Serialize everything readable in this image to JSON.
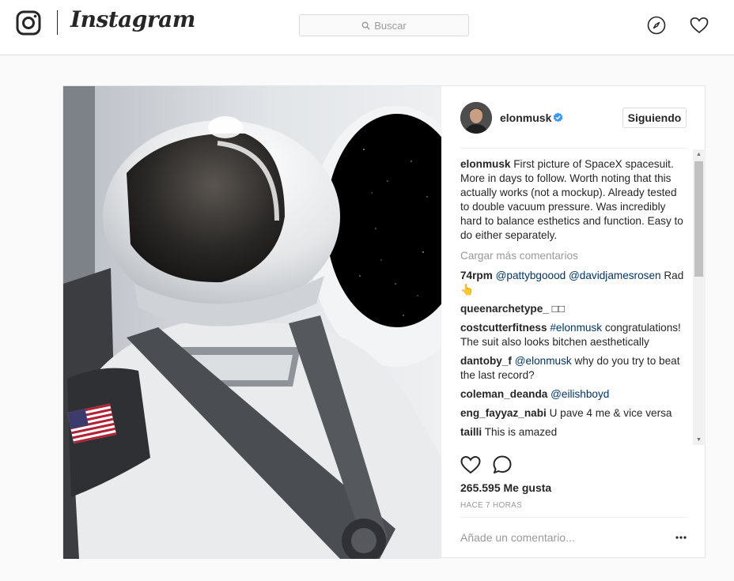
{
  "header": {
    "wordmark": "Instagram",
    "search_placeholder": "Buscar",
    "icons": [
      "instagram-glyph-icon",
      "search-icon",
      "compass-icon",
      "heart-icon"
    ]
  },
  "post": {
    "author": {
      "username": "elonmusk",
      "follow_label": "Siguiendo"
    },
    "caption": {
      "username": "elonmusk",
      "text": "First picture of SpaceX spacesuit. More in days to follow. Worth noting that this actually works (not a mockup). Already tested to double vacuum pressure. Was incredibly hard to balance esthetics and function. Easy to do either separately."
    },
    "load_more_label": "Cargar más comentarios",
    "comments": [
      {
        "user": "74rpm",
        "mentions": "@pattybgoood @davidjamesrosen",
        "text": "Rad 👆"
      },
      {
        "user": "queenarchetype_",
        "mentions": "",
        "text": "□□"
      },
      {
        "user": "costcutterfitness",
        "mentions": "#elonmusk",
        "text": "congratulations! The suit also looks bitchen aesthetically"
      },
      {
        "user": "dantoby_f",
        "mentions": "@elonmusk",
        "text": "why do you try to beat the last record?"
      },
      {
        "user": "coleman_deanda",
        "mentions": "@eilishboyd",
        "text": ""
      },
      {
        "user": "eng_fayyaz_nabi",
        "mentions": "",
        "text": "U pave 4 me & vice versa"
      },
      {
        "user": "tailli",
        "mentions": "",
        "text": "This is amazed"
      }
    ],
    "likes": "265.595 Me gusta",
    "time": "HACE 7 HORAS",
    "add_comment_placeholder": "Añade un comentario...",
    "colors": {
      "link": "#003569",
      "verified": "#3897f0",
      "border": "#dbdbdb"
    }
  }
}
